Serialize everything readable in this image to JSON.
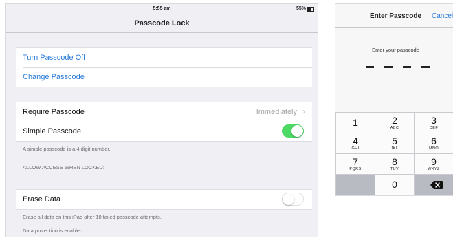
{
  "left": {
    "status_time": "5:55 am",
    "status_battery": "55%",
    "nav_title": "Passcode Lock",
    "group1": {
      "turn_off": "Turn Passcode Off",
      "change": "Change Passcode"
    },
    "group2": {
      "require_label": "Require Passcode",
      "require_value": "Immediately",
      "simple_label": "Simple Passcode",
      "simple_on": true
    },
    "simple_note": "A simple passcode is a 4 digit number.",
    "allow_header": "ALLOW ACCESS WHEN LOCKED:",
    "group3": {
      "erase_label": "Erase Data",
      "erase_on": false
    },
    "erase_note": "Erase all data on this iPad after 10 failed passcode attempts.",
    "protection_note": "Data protection is enabled."
  },
  "right": {
    "title": "Enter Passcode",
    "cancel": "Cancel",
    "prompt": "Enter your passcode",
    "keys": [
      {
        "num": "1",
        "letters": ""
      },
      {
        "num": "2",
        "letters": "ABC"
      },
      {
        "num": "3",
        "letters": "DEF"
      },
      {
        "num": "4",
        "letters": "GHI"
      },
      {
        "num": "5",
        "letters": "JKL"
      },
      {
        "num": "6",
        "letters": "MNO"
      },
      {
        "num": "7",
        "letters": "PQRS"
      },
      {
        "num": "8",
        "letters": "TUV"
      },
      {
        "num": "9",
        "letters": "WXYZ"
      },
      {
        "num": "0",
        "letters": ""
      }
    ]
  },
  "colors": {
    "accent": "#2a7ad8",
    "toggle_on": "#4cd964",
    "background": "#efeff4"
  },
  "icons": [
    "battery-icon",
    "chevron-right-icon",
    "delete-backspace-icon"
  ]
}
